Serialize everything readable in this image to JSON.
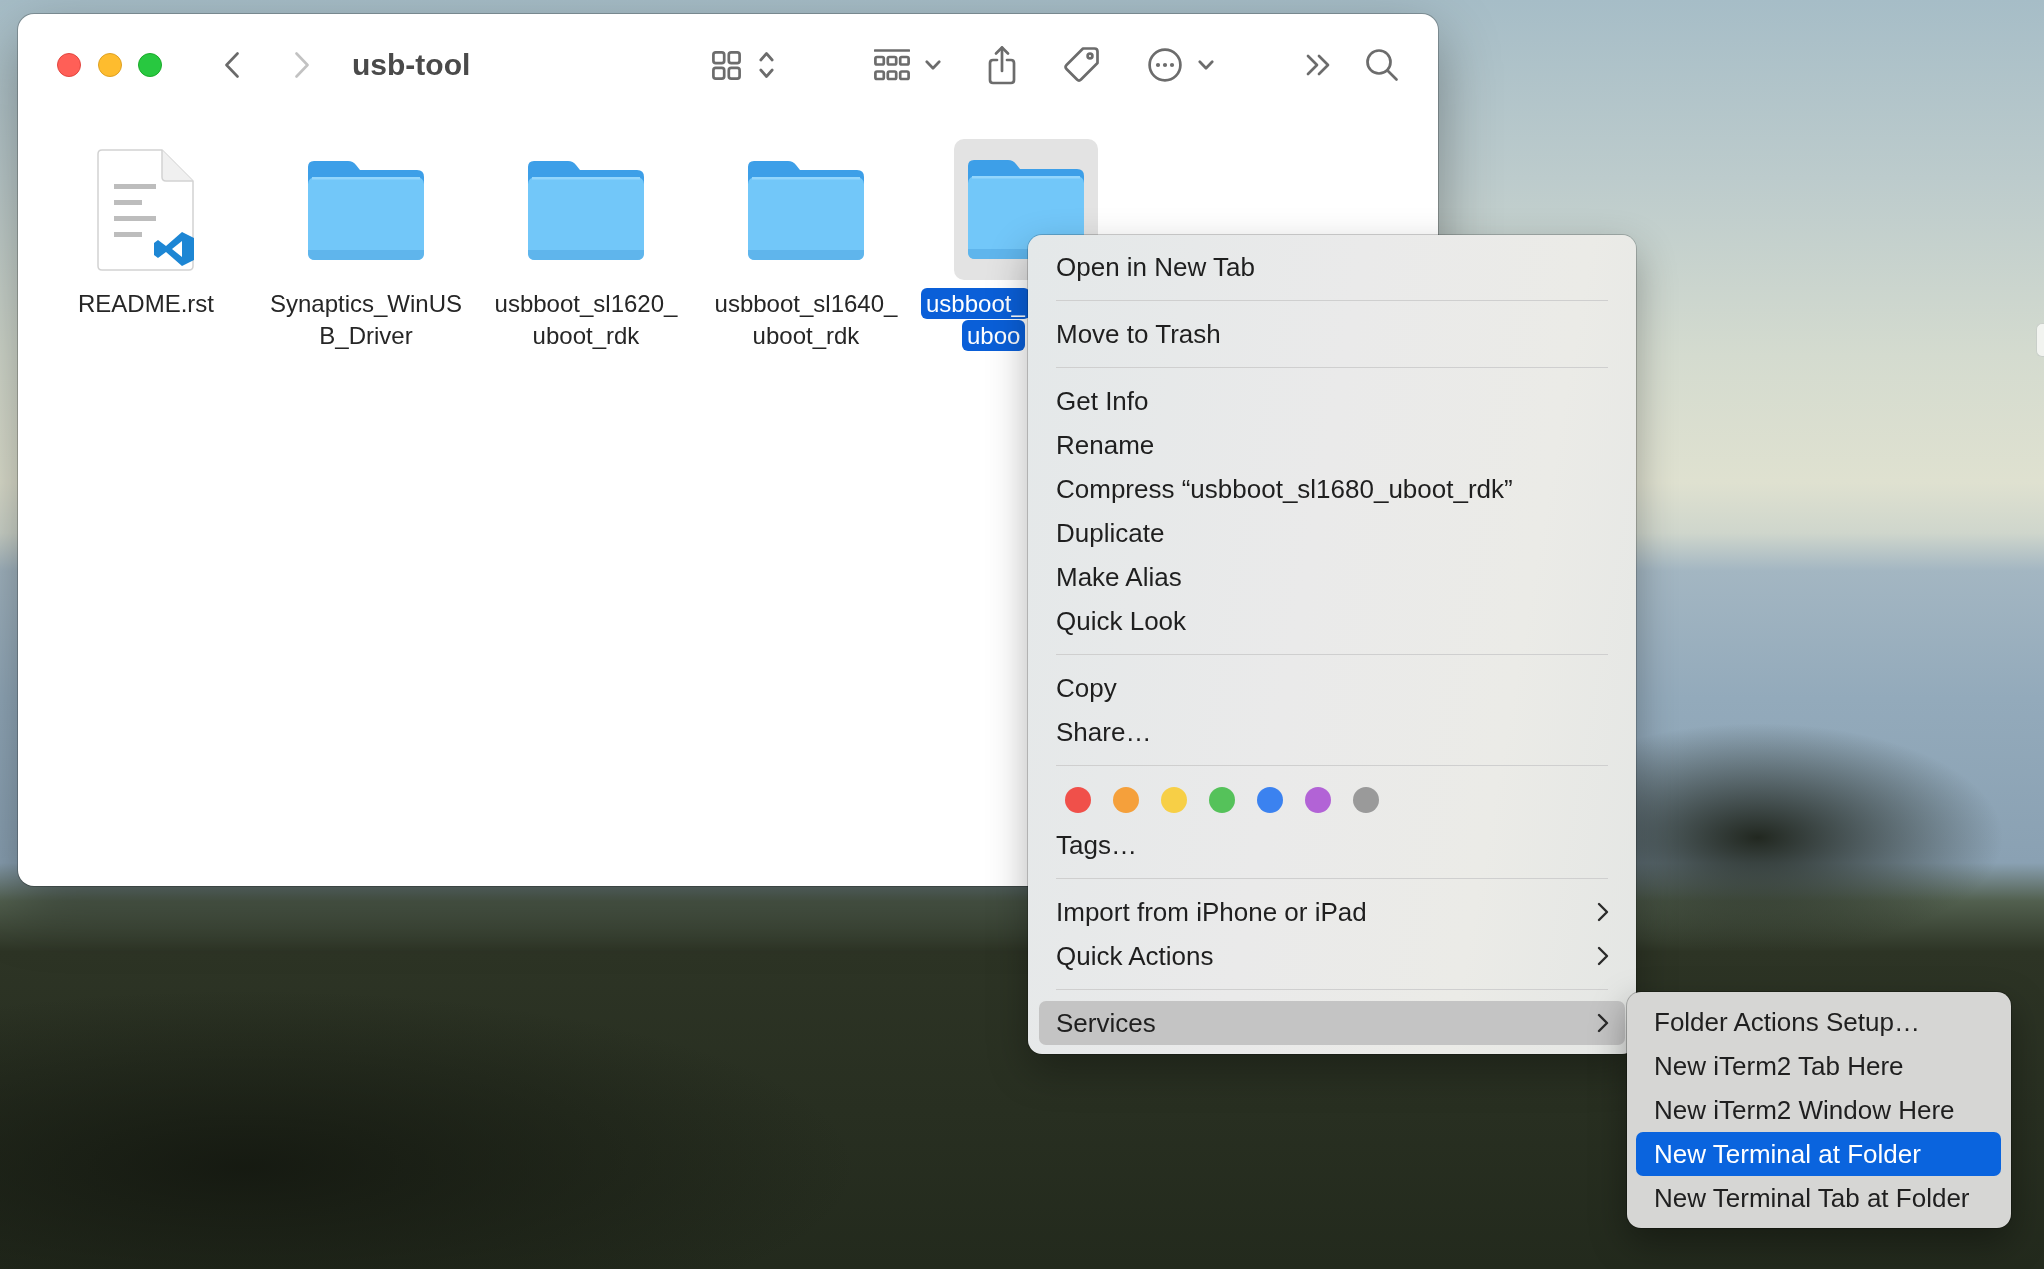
{
  "window": {
    "title": "usb-tool",
    "navigation": [
      {
        "kind": "back",
        "disabled": false
      },
      {
        "kind": "forward",
        "disabled": true
      }
    ]
  },
  "files": [
    {
      "kind": "document",
      "name_lines": [
        "README.rst"
      ],
      "selected": false
    },
    {
      "kind": "folder",
      "name_lines": [
        "Synaptics_WinUS",
        "B_Driver"
      ],
      "selected": false
    },
    {
      "kind": "folder",
      "name_lines": [
        "usbboot_sl1620_",
        "uboot_rdk"
      ],
      "selected": false
    },
    {
      "kind": "folder",
      "name_lines": [
        "usbboot_sl1640_",
        "uboot_rdk"
      ],
      "selected": false
    },
    {
      "kind": "folder",
      "name_lines": [
        "usbboot_",
        "uboo"
      ],
      "selected": true
    }
  ],
  "context_menu": {
    "sections": [
      {
        "items": [
          {
            "kind": "item",
            "label": "Open in New Tab",
            "has_submenu": false,
            "selected": false
          }
        ]
      },
      {
        "items": [
          {
            "kind": "item",
            "label": "Move to Trash",
            "has_submenu": false,
            "selected": false
          }
        ]
      },
      {
        "items": [
          {
            "kind": "item",
            "label": "Get Info",
            "has_submenu": false,
            "selected": false
          },
          {
            "kind": "item",
            "label": "Rename",
            "has_submenu": false,
            "selected": false
          },
          {
            "kind": "item",
            "label": "Compress “usbboot_sl1680_uboot_rdk”",
            "has_submenu": false,
            "selected": false
          },
          {
            "kind": "item",
            "label": "Duplicate",
            "has_submenu": false,
            "selected": false
          },
          {
            "kind": "item",
            "label": "Make Alias",
            "has_submenu": false,
            "selected": false
          },
          {
            "kind": "item",
            "label": "Quick Look",
            "has_submenu": false,
            "selected": false
          }
        ]
      },
      {
        "items": [
          {
            "kind": "item",
            "label": "Copy",
            "has_submenu": false,
            "selected": false
          },
          {
            "kind": "item",
            "label": "Share…",
            "has_submenu": false,
            "selected": false
          }
        ]
      },
      {
        "items": [
          {
            "kind": "tags",
            "tags": [
              {
                "color": "#f0504a"
              },
              {
                "color": "#f5a03b"
              },
              {
                "color": "#f7cf46"
              },
              {
                "color": "#55c25a"
              },
              {
                "color": "#3b82f0"
              },
              {
                "color": "#b263d6"
              },
              {
                "color": "#9a9a9a"
              }
            ]
          },
          {
            "kind": "item",
            "label": "Tags…",
            "has_submenu": false,
            "selected": false
          }
        ]
      },
      {
        "items": [
          {
            "kind": "item",
            "label": "Import from iPhone or iPad",
            "has_submenu": true,
            "selected": false
          },
          {
            "kind": "item",
            "label": "Quick Actions",
            "has_submenu": true,
            "selected": false
          }
        ]
      },
      {
        "items": [
          {
            "kind": "item",
            "label": "Services",
            "has_submenu": true,
            "selected": true
          }
        ]
      }
    ]
  },
  "submenu": {
    "items": [
      {
        "label": "Folder Actions Setup…",
        "selected": false
      },
      {
        "label": "New iTerm2 Tab Here",
        "selected": false
      },
      {
        "label": "New iTerm2 Window Here",
        "selected": false
      },
      {
        "label": "New Terminal at Folder",
        "selected": true
      },
      {
        "label": "New Terminal Tab at Folder",
        "selected": false
      }
    ]
  }
}
